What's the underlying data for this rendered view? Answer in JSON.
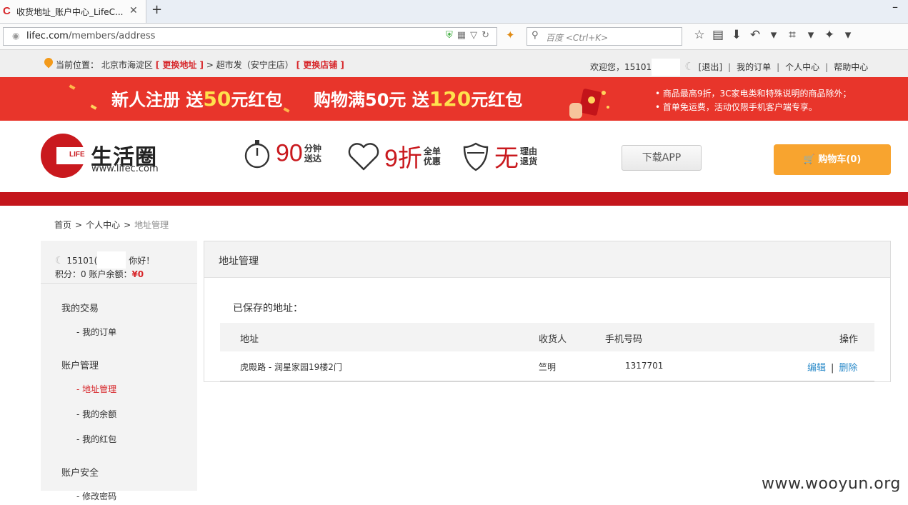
{
  "browser": {
    "tab_title": "收货地址_账户中心_LifeC...",
    "tab_close": "✕",
    "new_tab": "+",
    "minimize": "–",
    "url_domain": "lifec.com",
    "url_path": "/members/address",
    "search_placeholder": "百度 <Ctrl+K>"
  },
  "topbar": {
    "location_label": "当前位置：",
    "location_value": "北京市海淀区",
    "change_address": "[ 更换地址 ]",
    "store_arrow": ">",
    "store": "超市发（安宁庄店）",
    "change_store": "[ 更换店铺 ]",
    "welcome": "欢迎您，15101",
    "logout": "[退出]",
    "my_orders": "我的订单",
    "user_center": "个人中心",
    "help_center": "帮助中心",
    "separator": "|"
  },
  "banner": {
    "promo1_a": "新人注册 送",
    "promo1_num": "50",
    "promo1_b": "元红包",
    "promo2_a": "购物满50元 送",
    "promo2_num": "120",
    "promo2_b": "元红包",
    "note1": "• 商品最高9折，3C家电类和特殊说明的商品除外；",
    "note2": "• 首单免运费，活动仅限手机客户端专享。"
  },
  "header": {
    "logo_mark": "LIFE",
    "logo_name": "生活圈",
    "logo_url": "www.lifec.com",
    "feature1_big": "90",
    "feature1_small_1": "分钟",
    "feature1_small_2": "送达",
    "feature2_big": "9折",
    "feature2_small_1": "全单",
    "feature2_small_2": "优惠",
    "feature3_big": "无",
    "feature3_small_1": "理由",
    "feature3_small_2": "退货",
    "download_app": "下载APP",
    "cart": "购物车(0)"
  },
  "breadcrumb": {
    "home": "首页",
    "center": "个人中心",
    "current": "地址管理",
    "sep": ">"
  },
  "sidebar": {
    "user_prefix": "15101(",
    "greeting": "你好！",
    "points": "积分：0 账户余额：",
    "balance": "¥0",
    "sections": [
      {
        "title": "我的交易",
        "items": [
          "- 我的订单"
        ]
      },
      {
        "title": "账户管理",
        "items": [
          "- 地址管理",
          "- 我的余额",
          "- 我的红包"
        ]
      },
      {
        "title": "账户安全",
        "items": [
          "- 修改密码"
        ]
      }
    ]
  },
  "main": {
    "panel_title": "地址管理",
    "saved_label": "已保存的地址：",
    "columns": [
      "地址",
      "收货人",
      "手机号码",
      "操作"
    ],
    "rows": [
      {
        "address": "虎殿路 - 润星家园19楼2门",
        "receiver": "竺明",
        "phone": "1317701",
        "edit": "编辑",
        "delete": "删除"
      }
    ],
    "action_sep": "|"
  },
  "watermark": "www.wooyun.org",
  "colors": {
    "brand_red": "#c9191e",
    "banner_red": "#e8352b",
    "cart_orange": "#f8a42f",
    "link_blue": "#2a8ac9"
  },
  "icons": {
    "favicon": "C",
    "globe": "◉",
    "shield": "⛨",
    "qr": "▦",
    "dropdown": "▽",
    "reload": "↻",
    "search": "⚲",
    "star": "☆",
    "reader": "▤",
    "download": "⬇",
    "undo": "↶",
    "crop": "⌗",
    "menu": "▾",
    "fox": "✦",
    "cart": "🛒",
    "moon": "☾"
  }
}
